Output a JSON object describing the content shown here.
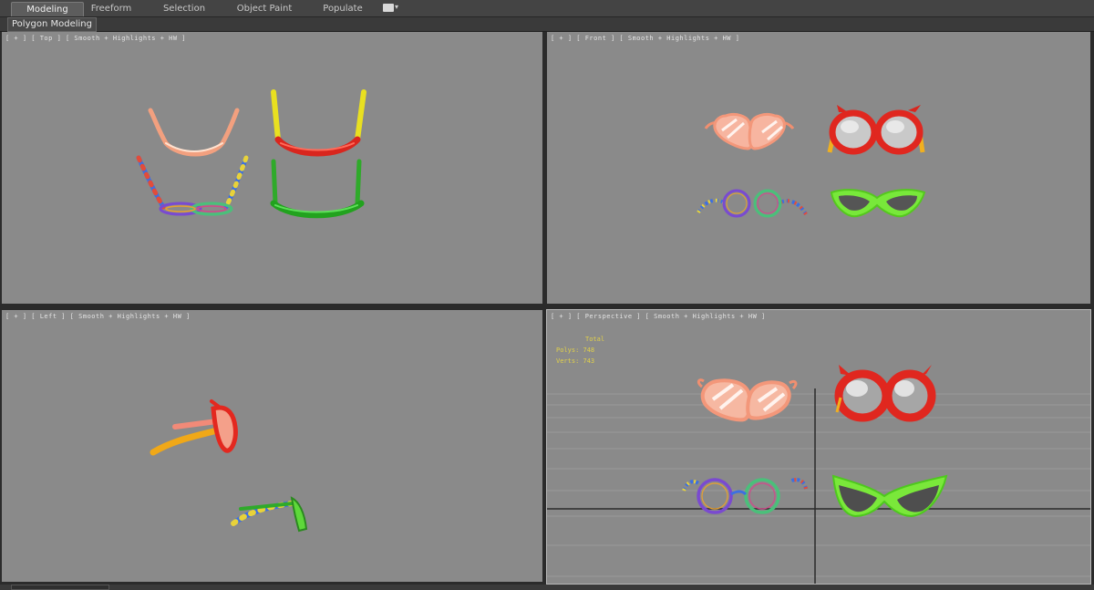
{
  "ribbon": {
    "tabs": [
      {
        "label": "Modeling",
        "active": true
      },
      {
        "label": "Freeform",
        "active": false
      },
      {
        "label": "Selection",
        "active": false
      },
      {
        "label": "Object Paint",
        "active": false
      },
      {
        "label": "Populate",
        "active": false
      }
    ],
    "panel_label": "Polygon Modeling"
  },
  "viewports": {
    "top": {
      "label": "[ + ] [ Top ] [ Smooth + Highlights + HW ]"
    },
    "front": {
      "label": "[ + ] [ Front ] [ Smooth + Highlights + HW ]"
    },
    "left": {
      "label": "[ + ] [ Left ] [ Smooth + Highlights + HW ]"
    },
    "perspective": {
      "label": "[ + ] [ Perspective ] [ Smooth + Highlights + HW ]",
      "stats": {
        "title": "Total",
        "polys": "Polys:  748",
        "verts": "Verts:  743"
      }
    }
  },
  "colors": {
    "viewport_bg": "#8a8a8a",
    "heart_pink": "#f6a58a",
    "devil_red": "#e02a22",
    "devil_temple": "#f0b020",
    "cat_green": "#6ee52e",
    "lens_gray": "#777777"
  }
}
